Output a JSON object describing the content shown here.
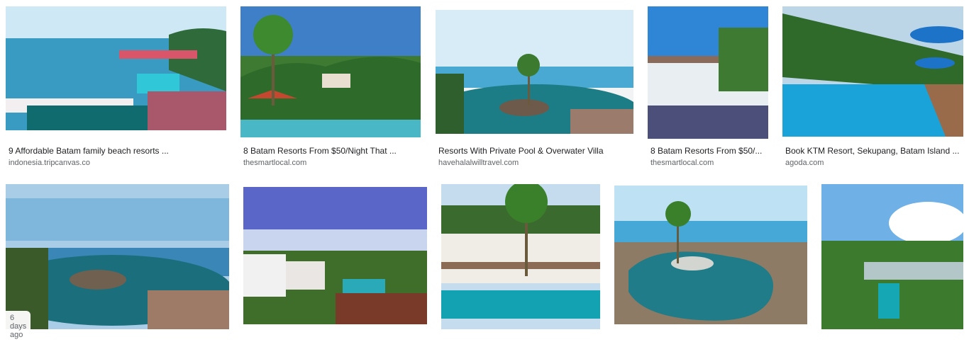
{
  "results": [
    {
      "title": "9 Affordable Batam family beach resorts ...",
      "source": "indonesia.tripcanvas.co",
      "image": "overwater-villas-pool-sea"
    },
    {
      "title": "8 Batam Resorts From $50/Night That ...",
      "source": "thesmartlocal.com",
      "image": "palm-tree-pool-resort"
    },
    {
      "title": "Resorts With Private Pool & Overwater Villa",
      "source": "havehalalwilltravel.com",
      "image": "infinity-pool-island-palms"
    },
    {
      "title": "8 Batam Resorts From $50/...",
      "source": "thesmartlocal.com",
      "image": "white-hotel-building-pool"
    },
    {
      "title": "Book KTM Resort, Sekupang, Batam Island ...",
      "source": "agoda.com",
      "image": "lap-pool-blue-umbrellas"
    },
    {
      "image": "infinity-pool-island-palms",
      "badge": "6 days ago"
    },
    {
      "image": "hillside-villas-sea"
    },
    {
      "image": "tropical-hotel-pool-palm"
    },
    {
      "image": "lagoon-pool-island-deck"
    },
    {
      "image": "aerial-garden-pool"
    }
  ]
}
